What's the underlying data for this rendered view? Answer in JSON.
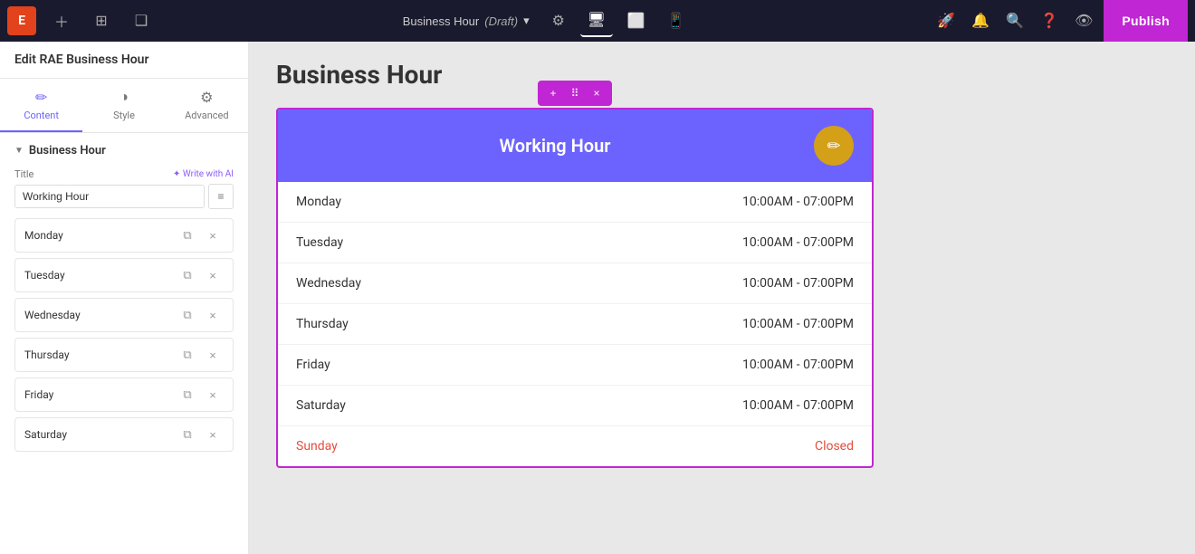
{
  "topbar": {
    "logo_label": "E",
    "page_title": "Business Hour",
    "page_status": "(Draft)",
    "publish_label": "Publish",
    "settings_icon": "⚙",
    "desktop_icon": "🖥",
    "tablet_icon": "📱",
    "mobile_icon": "📱",
    "rocket_icon": "🚀",
    "bell_icon": "🔔",
    "search_icon": "🔍",
    "help_icon": "?",
    "eye_icon": "👁"
  },
  "sidebar": {
    "header_title": "Edit RAE Business Hour",
    "tabs": [
      {
        "id": "content",
        "label": "Content",
        "icon": "✏"
      },
      {
        "id": "style",
        "label": "Style",
        "icon": "◑"
      },
      {
        "id": "advanced",
        "label": "Advanced",
        "icon": "⚙"
      }
    ],
    "section_title": "Business Hour",
    "title_field_label": "Title",
    "write_ai_label": "✦ Write with AI",
    "title_value": "Working Hour",
    "days": [
      {
        "id": "monday",
        "label": "Monday"
      },
      {
        "id": "tuesday",
        "label": "Tuesday"
      },
      {
        "id": "wednesday",
        "label": "Wednesday"
      },
      {
        "id": "thursday",
        "label": "Thursday"
      },
      {
        "id": "friday",
        "label": "Friday"
      },
      {
        "id": "saturday",
        "label": "Saturday"
      }
    ]
  },
  "canvas": {
    "page_heading": "Business Hour",
    "widget_title": "Working Hour",
    "schedule": [
      {
        "day": "Monday",
        "hours": "10:00AM - 07:00PM",
        "closed": false
      },
      {
        "day": "Tuesday",
        "hours": "10:00AM - 07:00PM",
        "closed": false
      },
      {
        "day": "Wednesday",
        "hours": "10:00AM - 07:00PM",
        "closed": false
      },
      {
        "day": "Thursday",
        "hours": "10:00AM - 07:00PM",
        "closed": false
      },
      {
        "day": "Friday",
        "hours": "10:00AM - 07:00PM",
        "closed": false
      },
      {
        "day": "Saturday",
        "hours": "10:00AM - 07:00PM",
        "closed": false
      },
      {
        "day": "Sunday",
        "hours": "Closed",
        "closed": true
      }
    ]
  },
  "widget_toolbar": {
    "add_icon": "+",
    "move_icon": "⠿",
    "close_icon": "×"
  },
  "colors": {
    "header_bg": "#6c63ff",
    "publish_bg": "#c026d3",
    "edit_circle": "#d4a017",
    "sunday_color": "#e74c3c"
  }
}
